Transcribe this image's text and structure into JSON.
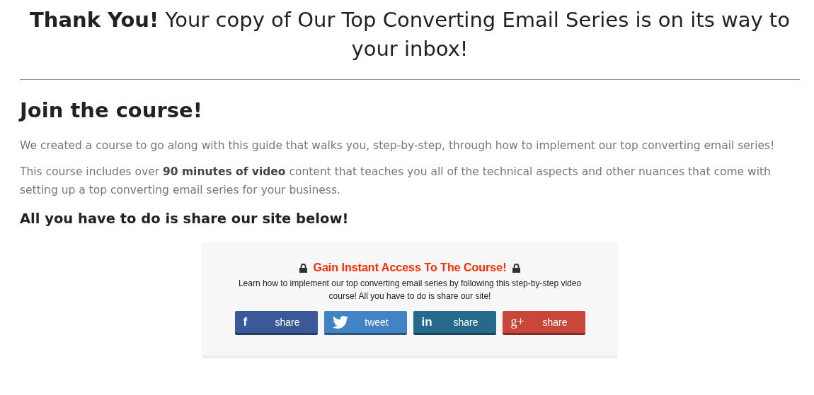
{
  "headline": "**Thank You!** Your copy of Our Top Converting Email Series is on its way to your inbox!",
  "heading": "Join the course!",
  "paragraphs": [
    "We created a course to go along with this guide that walks you, step-by-step, through how to implement our top converting email series!",
    "This course includes over **90 minutes of video** content that teaches you all of the technical aspects and other nuances that come with setting up a top converting email series for your business."
  ],
  "subheading": "All you have to do is share our site below!",
  "share_box": {
    "title": "Gain Instant Access To The Course!",
    "description": "Learn how to implement our top converting email series by following this step-by-step video course! All you have to do is share our site!",
    "buttons": [
      {
        "kind": "facebook",
        "icon": "f",
        "label": "share",
        "color": "#3b5998"
      },
      {
        "kind": "twitter",
        "label": "tweet",
        "color": "#4183c4"
      },
      {
        "kind": "linkedin",
        "icon": "in",
        "label": "share",
        "color": "#25698b"
      },
      {
        "kind": "googleplus",
        "icon": "g+",
        "label": "share",
        "color": "#c8473a"
      }
    ]
  }
}
